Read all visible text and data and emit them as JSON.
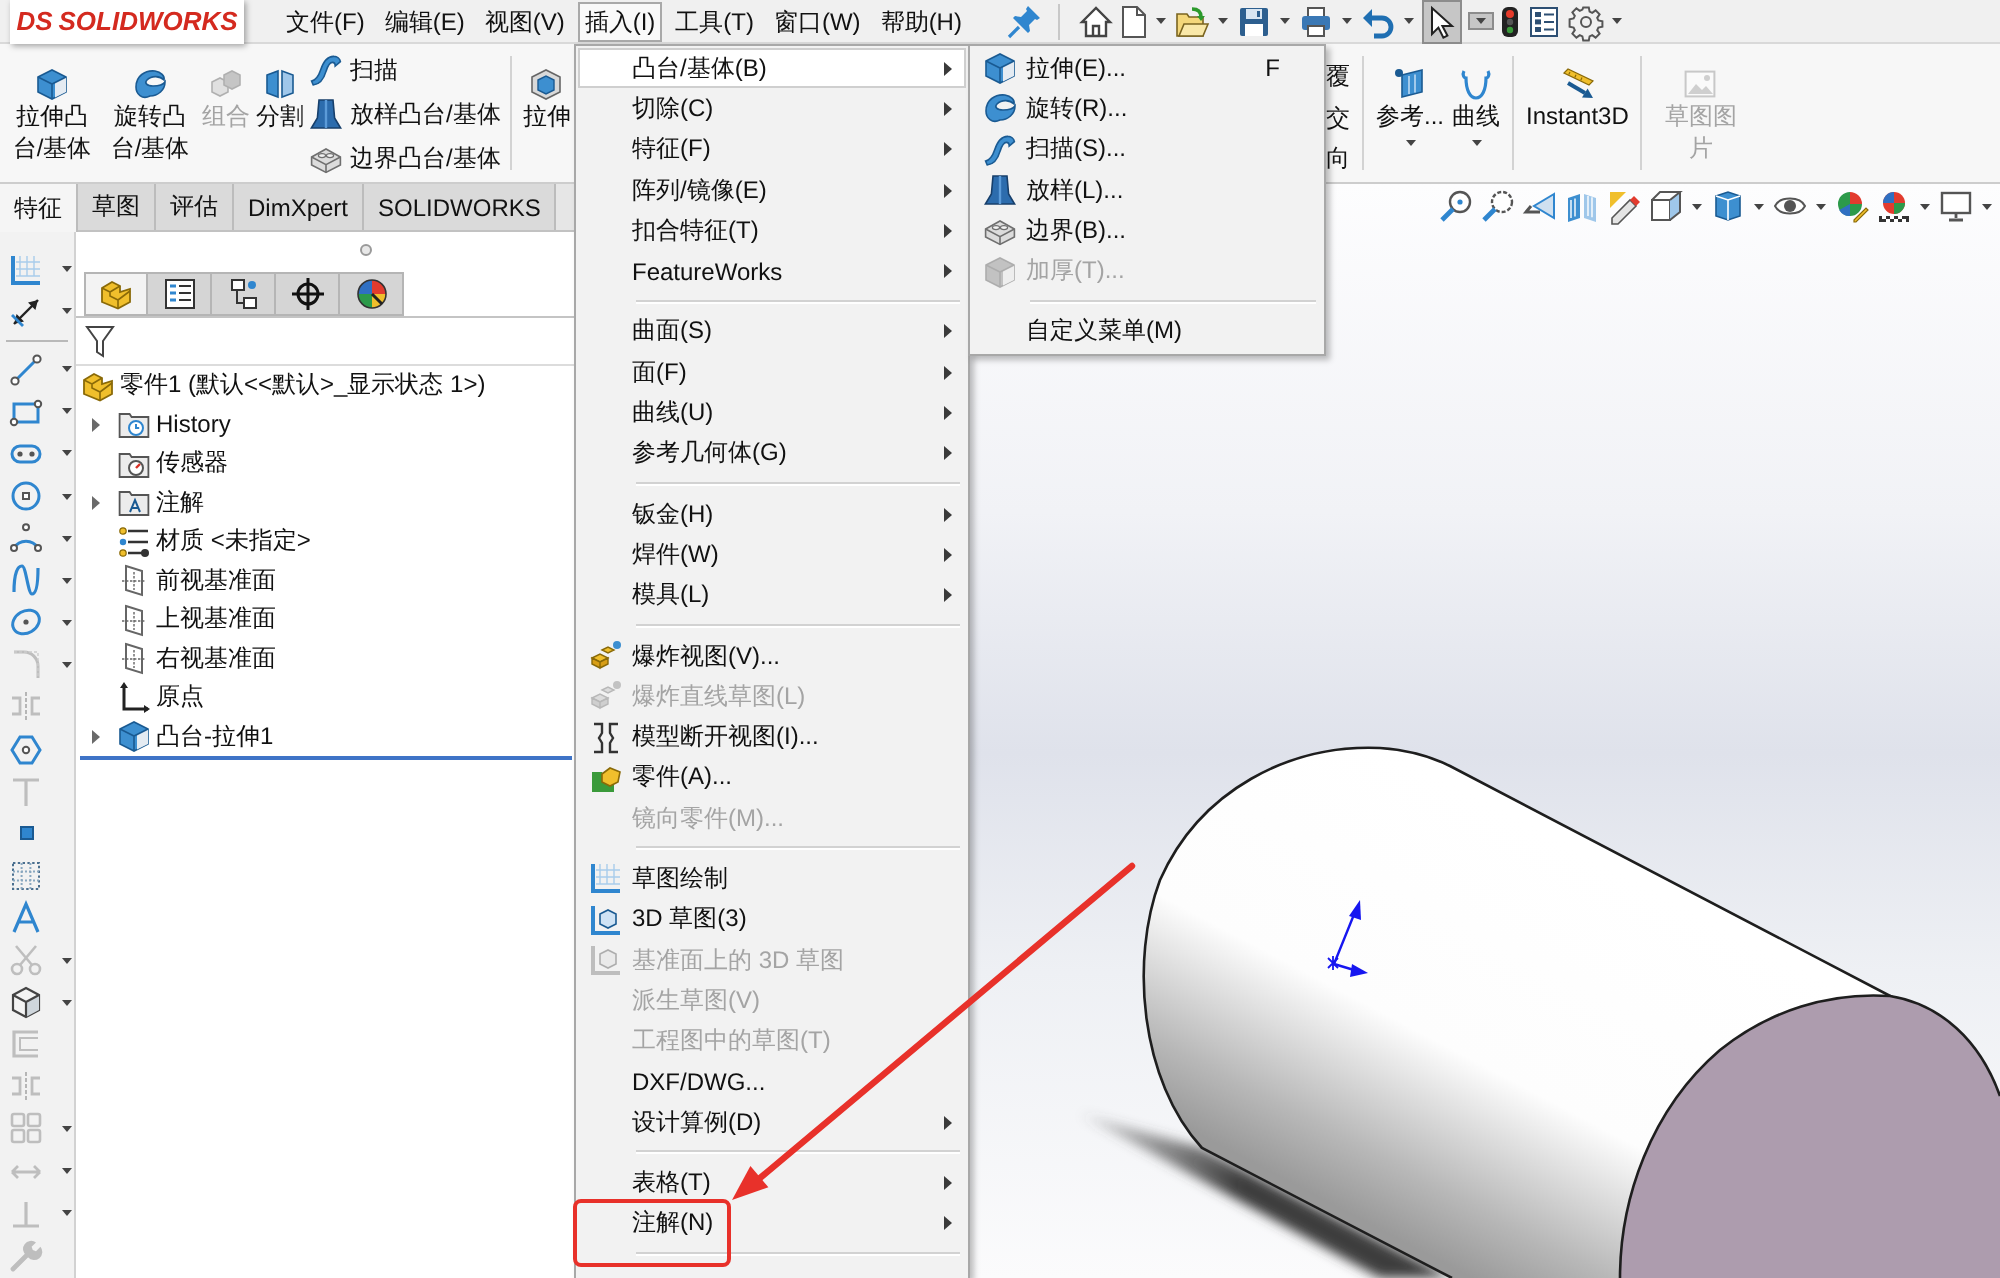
{
  "title_bar": {
    "logo_mark": "DS",
    "logo_text": "SOLIDWORKS",
    "menus": [
      {
        "label": "文件(F)",
        "selected": false
      },
      {
        "label": "编辑(E)",
        "selected": false
      },
      {
        "label": "视图(V)",
        "selected": false
      },
      {
        "label": "插入(I)",
        "selected": true
      },
      {
        "label": "工具(T)",
        "selected": false
      },
      {
        "label": "窗口(W)",
        "selected": false
      },
      {
        "label": "帮助(H)",
        "selected": false
      }
    ],
    "quick_access": [
      {
        "dropdown": false,
        "pressed": false
      },
      {
        "dropdown": true,
        "pressed": false
      },
      {
        "dropdown": true,
        "pressed": false
      },
      {
        "dropdown": true,
        "pressed": false
      },
      {
        "dropdown": true,
        "pressed": false
      },
      {
        "dropdown": true,
        "pressed": false
      },
      {
        "dropdown": true,
        "pressed": true
      },
      {
        "dropdown": false,
        "pressed": false
      },
      {
        "dropdown": false,
        "pressed": false
      },
      {
        "dropdown": true,
        "pressed": false
      }
    ]
  },
  "ribbon": {
    "left": [
      {
        "kind": "large",
        "label": "拉伸凸台/基体",
        "disabled": false,
        "dropdown": false
      },
      {
        "kind": "large",
        "label": "旋转凸台/基体",
        "disabled": false,
        "dropdown": false
      },
      {
        "kind": "large",
        "label": "组合",
        "disabled": true,
        "dropdown": false
      },
      {
        "kind": "large",
        "label": "分割",
        "disabled": false,
        "dropdown": false
      },
      {
        "kind": "stack",
        "items": [
          {
            "label": "扫描",
            "disabled": false
          },
          {
            "label": "放样凸台/基体",
            "disabled": false
          },
          {
            "label": "边界凸台/基体",
            "disabled": false
          }
        ]
      },
      {
        "kind": "separator"
      },
      {
        "kind": "large",
        "label": "拉伸",
        "disabled": false,
        "dropdown": false
      }
    ],
    "right": [
      {
        "kind": "label_stack",
        "items": [
          {
            "label": "覆"
          },
          {
            "label": "交"
          },
          {
            "label": "向"
          }
        ]
      },
      {
        "kind": "separator"
      },
      {
        "kind": "large",
        "label": "参考...",
        "disabled": false,
        "dropdown": true
      },
      {
        "kind": "large",
        "label": "曲线",
        "disabled": false,
        "dropdown": true
      },
      {
        "kind": "separator"
      },
      {
        "kind": "large",
        "label": "Instant3D",
        "disabled": false,
        "dropdown": false
      },
      {
        "kind": "separator"
      },
      {
        "kind": "large",
        "label": "草图图片",
        "disabled": true,
        "dropdown": false
      }
    ]
  },
  "tabs": [
    {
      "label": "特征",
      "selected": true
    },
    {
      "label": "草图",
      "selected": false
    },
    {
      "label": "评估",
      "selected": false
    },
    {
      "label": "DimXpert",
      "selected": false
    },
    {
      "label": "SOLIDWORKS",
      "selected": false
    }
  ],
  "sketch_toolbar": [
    {
      "kind": "sketch",
      "dropdown": true,
      "disabled": false
    },
    {
      "kind": "smart_dimension",
      "dropdown": true,
      "disabled": false
    },
    {
      "kind": "separator"
    },
    {
      "kind": "line",
      "dropdown": true,
      "disabled": false
    },
    {
      "kind": "rectangle",
      "dropdown": true,
      "disabled": false
    },
    {
      "kind": "slot",
      "dropdown": true,
      "disabled": false
    },
    {
      "kind": "circle",
      "dropdown": true,
      "disabled": false
    },
    {
      "kind": "arc",
      "dropdown": true,
      "disabled": false
    },
    {
      "kind": "spline",
      "dropdown": true,
      "disabled": false
    },
    {
      "kind": "ellipse",
      "dropdown": true,
      "disabled": false
    },
    {
      "kind": "fillet",
      "dropdown": true,
      "disabled": true
    },
    {
      "kind": "mirror",
      "dropdown": false,
      "disabled": true
    },
    {
      "kind": "polygon",
      "dropdown": false,
      "disabled": false
    },
    {
      "kind": "plane",
      "dropdown": false,
      "disabled": true
    },
    {
      "kind": "point",
      "dropdown": false,
      "disabled": false
    },
    {
      "kind": "grid",
      "dropdown": false,
      "disabled": false
    },
    {
      "kind": "text",
      "dropdown": false,
      "disabled": false
    },
    {
      "kind": "trim",
      "dropdown": true,
      "disabled": true
    },
    {
      "kind": "block",
      "dropdown": true,
      "disabled": false
    },
    {
      "kind": "offset",
      "dropdown": false,
      "disabled": true
    },
    {
      "kind": "mirror",
      "dropdown": false,
      "disabled": true
    },
    {
      "kind": "pattern",
      "dropdown": true,
      "disabled": true
    },
    {
      "kind": "move",
      "dropdown": true,
      "disabled": true
    },
    {
      "kind": "relation",
      "dropdown": true,
      "disabled": true
    },
    {
      "kind": "repair",
      "dropdown": false,
      "disabled": true
    }
  ],
  "feature_manager": {
    "tabs": [
      {
        "selected": true
      },
      {
        "selected": false
      },
      {
        "selected": false
      },
      {
        "selected": false
      },
      {
        "selected": false
      }
    ],
    "tree": [
      {
        "label": "零件1 (默认<<默认>_显示状态 1>)",
        "kind": "part",
        "expander": false,
        "children": [
          {
            "label": "History",
            "kind": "history_folder",
            "expander": true
          },
          {
            "label": "传感器",
            "kind": "sensor_folder",
            "expander": false
          },
          {
            "label": "注解",
            "kind": "annotation_folder",
            "expander": true
          },
          {
            "label": "材质 <未指定>",
            "kind": "material",
            "expander": false
          },
          {
            "label": "前视基准面",
            "kind": "plane",
            "expander": false
          },
          {
            "label": "上视基准面",
            "kind": "plane",
            "expander": false
          },
          {
            "label": "右视基准面",
            "kind": "plane",
            "expander": false
          },
          {
            "label": "原点",
            "kind": "origin",
            "expander": false
          },
          {
            "label": "凸台-拉伸1",
            "kind": "extrude_feature",
            "expander": true
          }
        ]
      }
    ]
  },
  "heads_up_toolbar": [
    {
      "dropdown": false
    },
    {
      "dropdown": false
    },
    {
      "dropdown": false
    },
    {
      "dropdown": false
    },
    {
      "dropdown": false
    },
    {
      "dropdown": true
    },
    {
      "dropdown": true
    },
    {
      "dropdown": true
    },
    {
      "dropdown": false
    },
    {
      "dropdown": true
    },
    {
      "dropdown": true
    }
  ],
  "menu": {
    "items": [
      {
        "kind": "item",
        "label": "凸台/基体(B)",
        "submenu": true,
        "disabled": false,
        "selected": true
      },
      {
        "kind": "item",
        "label": "切除(C)",
        "submenu": true,
        "disabled": false,
        "selected": false
      },
      {
        "kind": "item",
        "label": "特征(F)",
        "submenu": true,
        "disabled": false,
        "selected": false
      },
      {
        "kind": "item",
        "label": "阵列/镜像(E)",
        "submenu": true,
        "disabled": false,
        "selected": false
      },
      {
        "kind": "item",
        "label": "扣合特征(T)",
        "submenu": true,
        "disabled": false,
        "selected": false
      },
      {
        "kind": "item",
        "label": "FeatureWorks",
        "submenu": true,
        "disabled": false,
        "selected": false
      },
      {
        "kind": "separator"
      },
      {
        "kind": "item",
        "label": "曲面(S)",
        "submenu": true,
        "disabled": false,
        "selected": false
      },
      {
        "kind": "item",
        "label": "面(F)",
        "submenu": true,
        "disabled": false,
        "selected": false
      },
      {
        "kind": "item",
        "label": "曲线(U)",
        "submenu": true,
        "disabled": false,
        "selected": false
      },
      {
        "kind": "item",
        "label": "参考几何体(G)",
        "submenu": true,
        "disabled": false,
        "selected": false
      },
      {
        "kind": "separator"
      },
      {
        "kind": "item",
        "label": "钣金(H)",
        "submenu": true,
        "disabled": false,
        "selected": false
      },
      {
        "kind": "item",
        "label": "焊件(W)",
        "submenu": true,
        "disabled": false,
        "selected": false
      },
      {
        "kind": "item",
        "label": "模具(L)",
        "submenu": true,
        "disabled": false,
        "selected": false
      },
      {
        "kind": "separator"
      },
      {
        "kind": "item",
        "label": "爆炸视图(V)...",
        "submenu": false,
        "disabled": false,
        "selected": false
      },
      {
        "kind": "item",
        "label": "爆炸直线草图(L)",
        "submenu": false,
        "disabled": true,
        "selected": false
      },
      {
        "kind": "item",
        "label": "模型断开视图(I)...",
        "submenu": false,
        "disabled": false,
        "selected": false
      },
      {
        "kind": "item",
        "label": "零件(A)...",
        "submenu": false,
        "disabled": false,
        "selected": false
      },
      {
        "kind": "item",
        "label": "镜向零件(M)...",
        "submenu": false,
        "disabled": true,
        "selected": false
      },
      {
        "kind": "separator"
      },
      {
        "kind": "item",
        "label": "草图绘制",
        "submenu": false,
        "disabled": false,
        "selected": false
      },
      {
        "kind": "item",
        "label": "3D 草图(3)",
        "submenu": false,
        "disabled": false,
        "selected": false
      },
      {
        "kind": "item",
        "label": "基准面上的 3D 草图",
        "submenu": false,
        "disabled": true,
        "selected": false
      },
      {
        "kind": "item",
        "label": "派生草图(V)",
        "submenu": false,
        "disabled": true,
        "selected": false
      },
      {
        "kind": "item",
        "label": "工程图中的草图(T)",
        "submenu": false,
        "disabled": true,
        "selected": false
      },
      {
        "kind": "item",
        "label": "DXF/DWG...",
        "submenu": false,
        "disabled": false,
        "selected": false
      },
      {
        "kind": "item",
        "label": "设计算例(D)",
        "submenu": true,
        "disabled": false,
        "selected": false
      },
      {
        "kind": "separator"
      },
      {
        "kind": "item",
        "label": "表格(T)",
        "submenu": true,
        "disabled": false,
        "selected": false
      },
      {
        "kind": "item",
        "label": "注解(N)",
        "submenu": true,
        "disabled": false,
        "selected": false
      },
      {
        "kind": "separator"
      }
    ]
  },
  "submenu": {
    "items": [
      {
        "kind": "item",
        "label": "拉伸(E)...",
        "shortcut": "F",
        "submenu": false,
        "disabled": false,
        "selected": false
      },
      {
        "kind": "item",
        "label": "旋转(R)...",
        "submenu": false,
        "disabled": false,
        "selected": false
      },
      {
        "kind": "item",
        "label": "扫描(S)...",
        "submenu": false,
        "disabled": false,
        "selected": false
      },
      {
        "kind": "item",
        "label": "放样(L)...",
        "submenu": false,
        "disabled": false,
        "selected": false
      },
      {
        "kind": "item",
        "label": "边界(B)...",
        "submenu": false,
        "disabled": false,
        "selected": false
      },
      {
        "kind": "item",
        "label": "加厚(T)...",
        "submenu": false,
        "disabled": true,
        "selected": false
      },
      {
        "kind": "separator"
      },
      {
        "kind": "item",
        "label": "自定义菜单(M)",
        "submenu": false,
        "disabled": false,
        "selected": false
      }
    ]
  }
}
